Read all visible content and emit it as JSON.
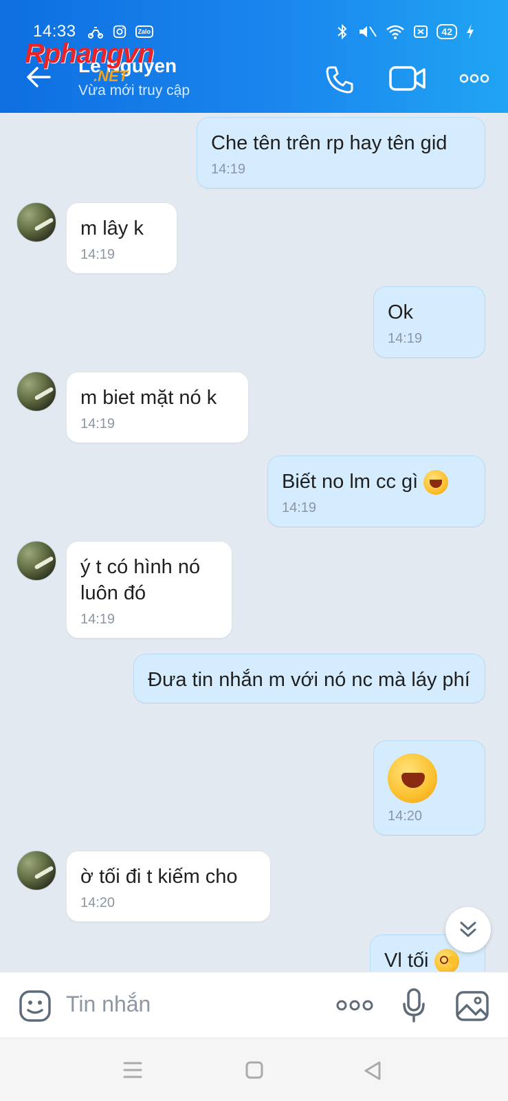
{
  "status_bar": {
    "time": "14:33",
    "zalo_label": "Zalo",
    "battery": "42"
  },
  "header": {
    "contact_name": "Le Nguyen",
    "contact_status": "Vừa mới truy cập",
    "watermark_main": "Rphangvn",
    "watermark_sub": ".NET"
  },
  "messages": [
    {
      "dir": "out",
      "text": "Che tên trên rp hay tên gid",
      "time": "14:19"
    },
    {
      "dir": "in",
      "text": "m lây k",
      "time": "14:19"
    },
    {
      "dir": "out",
      "text": "Ok",
      "time": "14:19"
    },
    {
      "dir": "in",
      "text": "m biet mặt nó k",
      "time": "14:19"
    },
    {
      "dir": "out",
      "text": "Biết no lm cc gì",
      "emoji": "laughing",
      "time": "14:19"
    },
    {
      "dir": "in",
      "text": "ý t có hình nó luôn đó",
      "time": "14:19"
    },
    {
      "dir": "out",
      "text": "Đưa tin nhắn m với nó nc mà láy phí",
      "time": ""
    },
    {
      "dir": "out",
      "text": "",
      "emoji": "laughing-big",
      "time": "14:20"
    },
    {
      "dir": "in",
      "text": "ờ tối đi t kiếm cho",
      "time": "14:20"
    },
    {
      "dir": "out",
      "text": "Vl tối",
      "emoji": "dizzy",
      "time": ""
    }
  ],
  "input": {
    "placeholder": "Tin nhắn"
  },
  "colors": {
    "header_start": "#0e6fe0",
    "header_end": "#20a4f3",
    "chat_bg": "#e2e9f1",
    "bubble_out": "#d4ecfd",
    "bubble_in": "#ffffff",
    "time_text": "#8a96a3"
  },
  "icons": {
    "back": "arrow-left-icon",
    "call": "phone-icon",
    "video": "video-camera-icon",
    "more": "more-dots-icon",
    "sticker": "sticker-icon",
    "mic": "microphone-icon",
    "image": "image-icon",
    "scroll": "chevron-double-down-icon"
  }
}
